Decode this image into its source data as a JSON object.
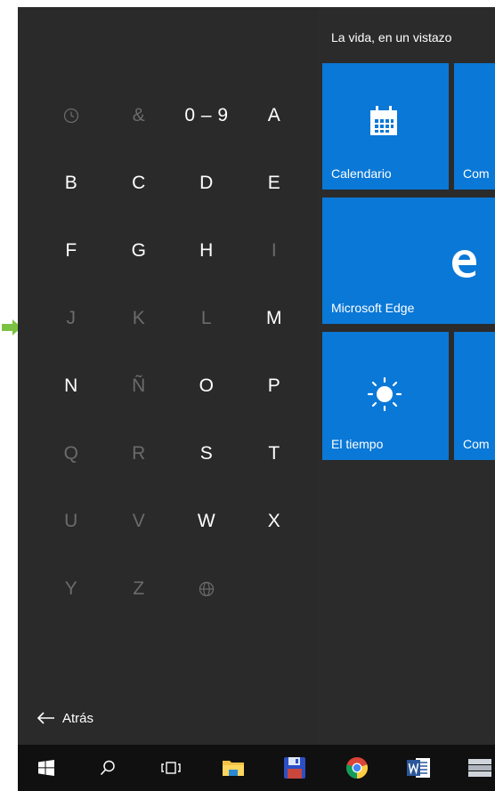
{
  "jump_list": {
    "letters": [
      {
        "label": "",
        "icon": "recent-clock-icon",
        "active": false
      },
      {
        "label": "&",
        "active": false
      },
      {
        "label": "0 – 9",
        "active": true
      },
      {
        "label": "A",
        "active": true
      },
      {
        "label": "B",
        "active": true
      },
      {
        "label": "C",
        "active": true
      },
      {
        "label": "D",
        "active": true
      },
      {
        "label": "E",
        "active": true
      },
      {
        "label": "F",
        "active": true
      },
      {
        "label": "G",
        "active": true
      },
      {
        "label": "H",
        "active": true
      },
      {
        "label": "I",
        "active": false
      },
      {
        "label": "J",
        "active": false
      },
      {
        "label": "K",
        "active": false
      },
      {
        "label": "L",
        "active": false
      },
      {
        "label": "M",
        "active": true
      },
      {
        "label": "N",
        "active": true
      },
      {
        "label": "Ñ",
        "active": false
      },
      {
        "label": "O",
        "active": true
      },
      {
        "label": "P",
        "active": true
      },
      {
        "label": "Q",
        "active": false
      },
      {
        "label": "R",
        "active": false
      },
      {
        "label": "S",
        "active": true
      },
      {
        "label": "T",
        "active": true
      },
      {
        "label": "U",
        "active": false
      },
      {
        "label": "V",
        "active": false
      },
      {
        "label": "W",
        "active": true
      },
      {
        "label": "X",
        "active": true
      },
      {
        "label": "Y",
        "active": false
      },
      {
        "label": "Z",
        "active": false
      },
      {
        "label": "",
        "icon": "globe-icon",
        "active": false
      }
    ],
    "back_label": "Atrás"
  },
  "tiles": {
    "group_title": "La vida, en un vistazo",
    "items": [
      {
        "name": "calendario",
        "label": "Calendario",
        "icon": "calendar-icon"
      },
      {
        "name": "com-1",
        "label": "Com",
        "icon": ""
      },
      {
        "name": "microsoft-edge",
        "label": "Microsoft Edge",
        "icon": "edge-icon"
      },
      {
        "name": "el-tiempo",
        "label": "El tiempo",
        "icon": "sun-icon"
      },
      {
        "name": "com-2",
        "label": "Com",
        "icon": ""
      }
    ],
    "accent_color": "#0a78d7"
  },
  "taskbar": {
    "items": [
      "windows-start-icon",
      "search-icon",
      "task-view-icon",
      "file-explorer-icon",
      "save-disk-icon",
      "chrome-icon",
      "word-icon",
      "app-stack-icon"
    ],
    "background": "#101010"
  },
  "colors": {
    "panel": "#2b2b2b",
    "dim_letter": "#6b6b6b",
    "arrow": "#7cc242"
  }
}
